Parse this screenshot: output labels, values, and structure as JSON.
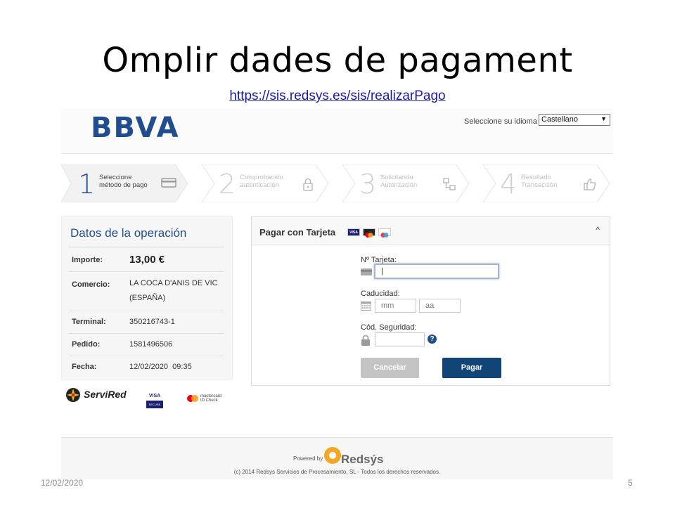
{
  "slide": {
    "title": "Omplir dades de pagament",
    "url": "https://sis.redsys.es/sis/realizarPago",
    "date": "12/02/2020",
    "page_number": "5"
  },
  "header": {
    "logo": "BBVA",
    "language_label": "Seleccione su idioma",
    "language_value": "Castellano",
    "language_caret": "▼"
  },
  "steps": [
    {
      "number": "1",
      "line1": "Seleccione",
      "line2": "método de pago",
      "icon": "card-icon",
      "active": true
    },
    {
      "number": "2",
      "line1": "Comprobación",
      "line2": "autenticación",
      "icon": "lock-icon",
      "active": false
    },
    {
      "number": "3",
      "line1": "Solicitando",
      "line2": "Autorización",
      "icon": "network-icon",
      "active": false
    },
    {
      "number": "4",
      "line1": "Resultado",
      "line2": "Transacción",
      "icon": "thumbs-up-icon",
      "active": false
    }
  ],
  "operation": {
    "title": "Datos de la operación",
    "rows": {
      "importe": {
        "label": "Importe:",
        "value": "13,00 €"
      },
      "comercio": {
        "label": "Comercio:",
        "value": "LA COCA D'ANIS DE VIC",
        "value2": "(ESPAÑA)"
      },
      "terminal": {
        "label": "Terminal:",
        "value": "350216743-1"
      },
      "pedido": {
        "label": "Pedido:",
        "value": "1581496506"
      },
      "fecha": {
        "label": "Fecha:",
        "value": "12/02/2020  09:35"
      }
    }
  },
  "logos": {
    "servired": "ServiRed",
    "visa_secure_top": "VISA",
    "visa_secure_bottom": "SECURE",
    "mastercard_line1": "mastercard",
    "mastercard_line2": "ID Check"
  },
  "payment": {
    "title": "Pagar con Tarjeta",
    "card_brands": [
      "VISA",
      "Mastercard",
      "Maestro"
    ],
    "collapse_icon": "^",
    "card_number_label": "Nº Tarjeta:",
    "card_number_value": "|",
    "expiry_label": "Caducidad:",
    "month_placeholder": "mm",
    "year_placeholder": "aa",
    "cvv_label": "Cód. Seguridad:",
    "help": "?",
    "cancel_label": "Cancelar",
    "pay_label": "Pagar"
  },
  "footer": {
    "powered_by": "Powered by",
    "brand": "Redsýs",
    "copyright": "(c) 2014 Redsys Servicios de Procesamiento, SL - Todos los derechos reservados."
  },
  "colors": {
    "brand_blue": "#1f4d8f",
    "pay_button": "#114577",
    "cancel_button": "#c4c4c4",
    "redsys_orange": "#f5a623"
  }
}
